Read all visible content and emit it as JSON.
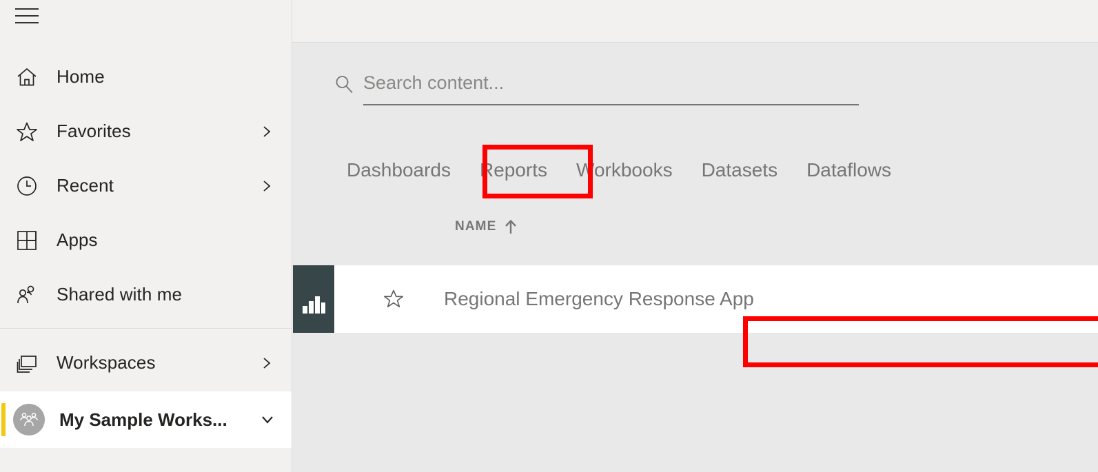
{
  "app": {
    "menu_icon": "hamburger-menu-icon"
  },
  "sidebar": {
    "items": [
      {
        "label": "Home",
        "icon": "home-icon",
        "chevron": false
      },
      {
        "label": "Favorites",
        "icon": "star-icon",
        "chevron": true
      },
      {
        "label": "Recent",
        "icon": "clock-icon",
        "chevron": true
      },
      {
        "label": "Apps",
        "icon": "apps-grid-icon",
        "chevron": false
      },
      {
        "label": "Shared with me",
        "icon": "shared-people-icon",
        "chevron": false
      }
    ],
    "workspaces": {
      "label": "Workspaces",
      "icon": "workspaces-stack-icon",
      "chevron": true
    },
    "selected_workspace": {
      "label": "My Sample Works...",
      "avatar_icon": "group-people-icon",
      "chevron": "chevron-down-icon",
      "accent_color": "#f2c811",
      "avatar_color": "#a6a6a6"
    }
  },
  "search": {
    "placeholder": "Search content...",
    "value": "",
    "icon": "search-icon"
  },
  "tabs": [
    {
      "label": "Dashboards",
      "selected": false
    },
    {
      "label": "Reports",
      "selected": true
    },
    {
      "label": "Workbooks",
      "selected": false
    },
    {
      "label": "Datasets",
      "selected": false
    },
    {
      "label": "Dataflows",
      "selected": false
    }
  ],
  "table": {
    "columns": [
      {
        "label": "NAME",
        "sort": "ascending",
        "sort_icon": "arrow-up-icon"
      }
    ],
    "rows": [
      {
        "name": "Regional Emergency Response App",
        "thumb_icon": "bar-chart-icon",
        "thumb_color": "#374649",
        "favorite_icon": "star-outline-icon",
        "favorite": false
      }
    ]
  },
  "annotations": {
    "color": "#ff0000",
    "boxes": [
      {
        "target": "Reports"
      },
      {
        "target": "Regional Emergency Response App"
      }
    ]
  }
}
